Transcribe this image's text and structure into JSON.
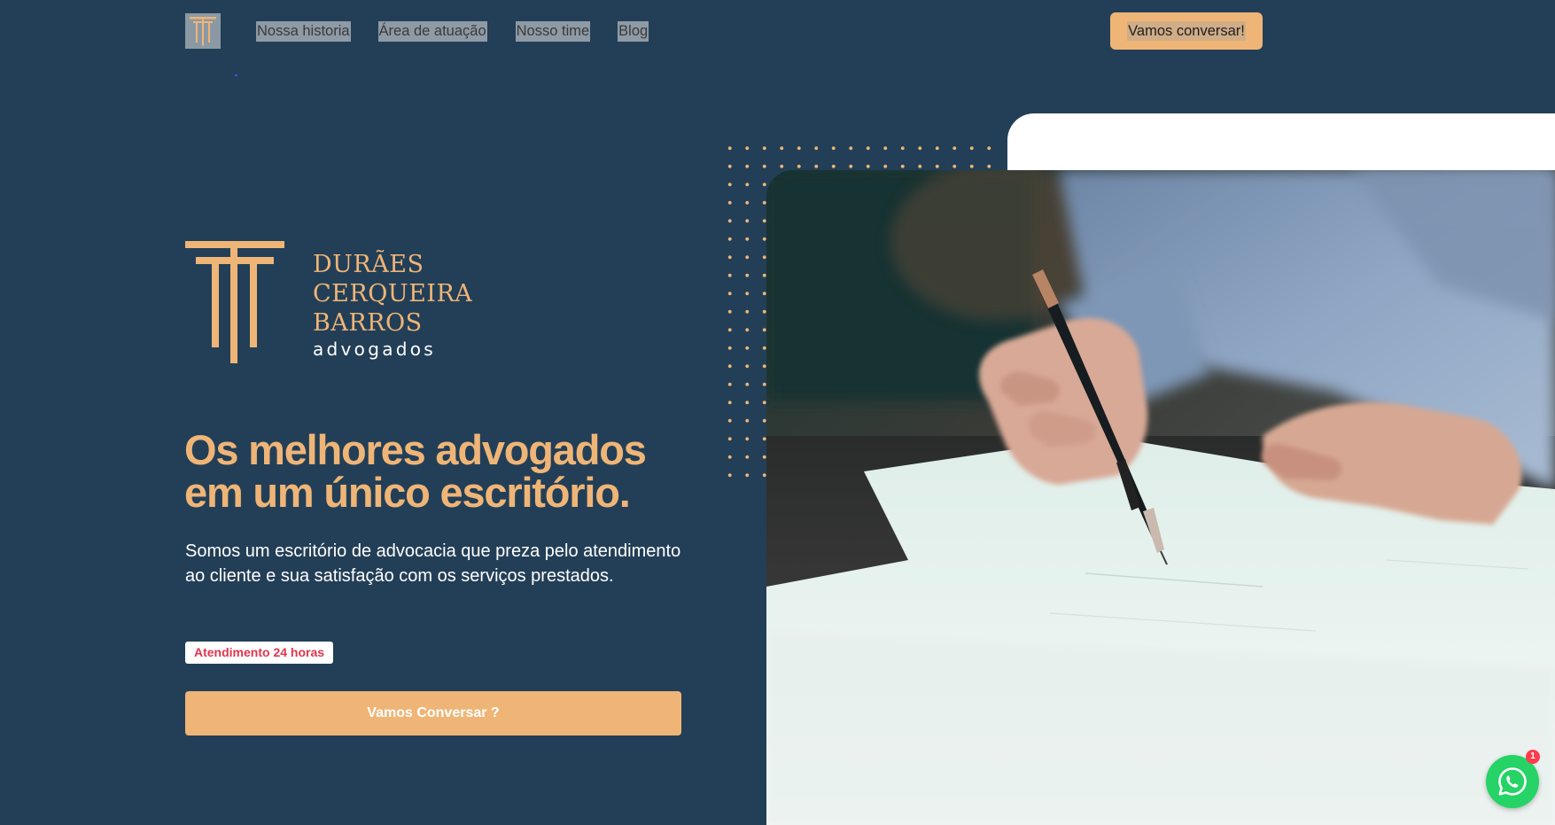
{
  "header": {
    "nav": [
      {
        "label": "Nossa historia"
      },
      {
        "label": "Área de atuação"
      },
      {
        "label": "Nosso time"
      },
      {
        "label": "Blog"
      }
    ],
    "cta_label": "Vamos conversar!"
  },
  "brand": {
    "line1": "DURÃES",
    "line2": "CERQUEIRA",
    "line3": "BARROS",
    "sub": "advogados",
    "icon": "columns-logo-icon"
  },
  "hero": {
    "headline_line1": "Os melhores advogados",
    "headline_line2": "em um único escritório.",
    "subtext": "Somos um escritório de advocacia que preza pelo atendimento ao cliente e sua satisfação com os serviços prestados.",
    "badge": "Atendimento 24 horas",
    "cta_label": "Vamos Conversar ?"
  },
  "whatsapp": {
    "icon": "whatsapp-icon",
    "badge_count": "1"
  },
  "colors": {
    "background": "#233f57",
    "accent": "#efb577",
    "whatsapp": "#25d366",
    "badge_text": "#e0344f"
  }
}
